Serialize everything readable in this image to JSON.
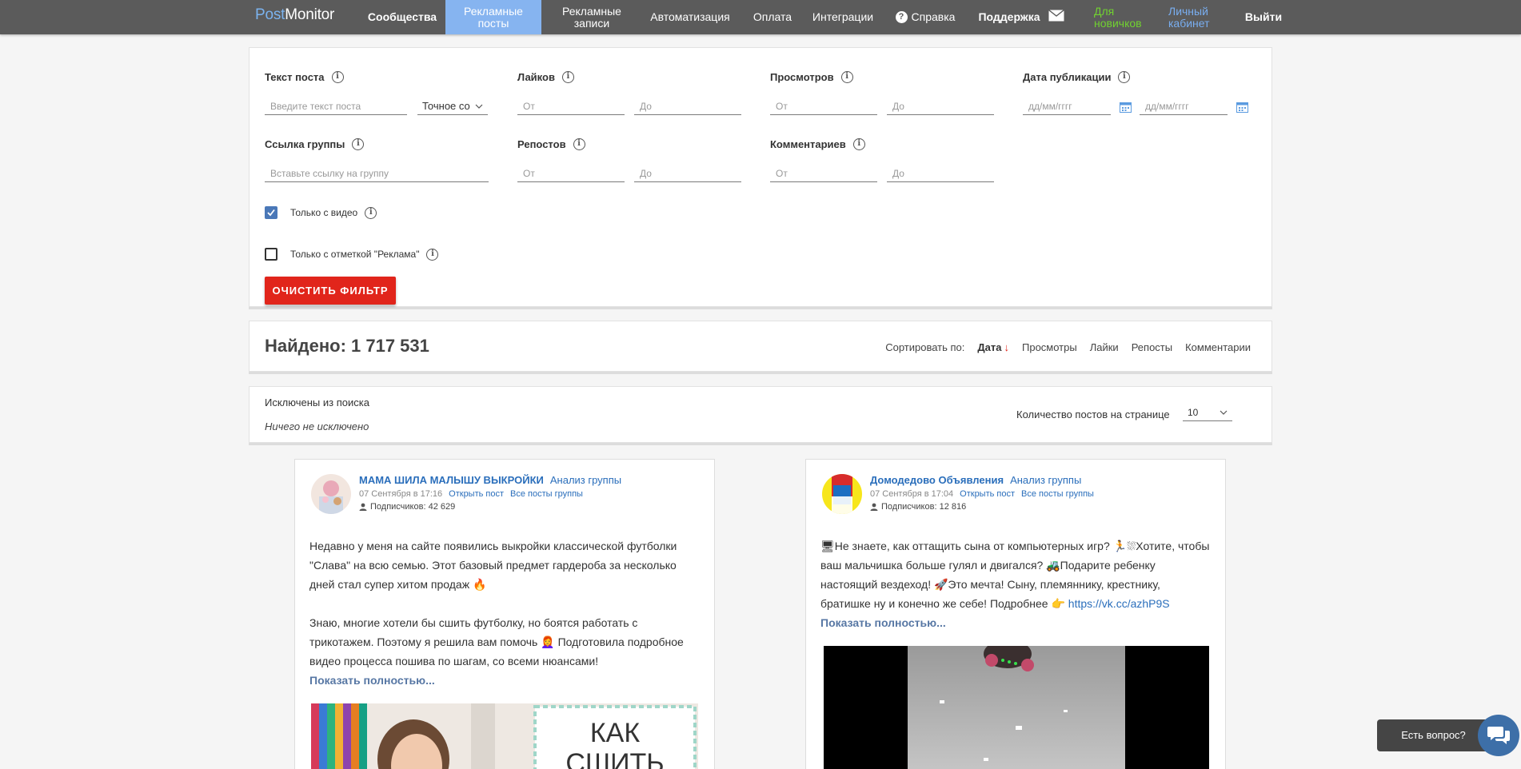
{
  "nav": {
    "logo_a": "Post",
    "logo_b": "Monitor",
    "items": [
      {
        "label": "Сообщества"
      },
      {
        "label": "Рекламные посты",
        "l1": "Рекламные",
        "l2": "посты"
      },
      {
        "label": "Рекламные записи",
        "l1": "Рекламные",
        "l2": "записи"
      },
      {
        "label": "Автоматизация"
      },
      {
        "label": "Оплата"
      },
      {
        "label": "Интеграции"
      },
      {
        "label": "Справка"
      },
      {
        "label": "Поддержка"
      },
      {
        "l1": "Для",
        "l2": "новичков"
      },
      {
        "l1": "Личный",
        "l2": "кабинет"
      },
      {
        "label": "Выйти"
      }
    ]
  },
  "filter": {
    "post_text_label": "Текст поста",
    "post_text_placeholder": "Введите текст поста",
    "match_mode": "Точное со",
    "likes_label": "Лайков",
    "views_label": "Просмотров",
    "date_label": "Дата публикации",
    "group_link_label": "Ссылка группы",
    "group_link_placeholder": "Вставьте ссылку на группу",
    "reposts_label": "Репостов",
    "comments_label": "Комментариев",
    "from_placeholder": "От",
    "to_placeholder": "До",
    "date_placeholder": "дд/мм/гггг",
    "only_video_label": "Только с видео",
    "only_video_checked": true,
    "only_ad_label": "Только с отметкой \"Реклама\"",
    "only_ad_checked": false,
    "clear_button": "Очистить фильтр"
  },
  "results": {
    "found_label": "Найдено: 1 717 531",
    "sort_label": "Сортировать по:",
    "sort_options": [
      "Дата",
      "Просмотры",
      "Лайки",
      "Репосты",
      "Комментарии"
    ],
    "sort_arrow": "↓",
    "active_sort": "Дата"
  },
  "exclusions": {
    "title": "Исключены из поиска",
    "none_text": "Ничего не исключено",
    "per_page_label": "Количество постов на странице",
    "per_page_value": "10"
  },
  "posts": [
    {
      "group_name": "МАМА ШИЛА МАЛЫШУ ВЫКРОЙКИ",
      "analysis_link": "Анализ группы",
      "date": "07 Сентября в 17:16",
      "open_post": "Открыть пост",
      "all_posts": "Все посты группы",
      "subscribers_label": "Подписчиков:",
      "subscribers": "42 629",
      "text_1": "Недавно у меня на сайте появились выкройки классической футболки \"Слава\" на всю семью. Этот базовый предмет гардероба за несколько дней стал супер хитом продаж 🔥",
      "text_2": "Знаю, многие хотели бы сшить футболку, но боятся работать с трикотажем. Поэтому я решила вам помочь 👩‍🦰 Подготовила подробное видео процесса пошива по шагам, со всеми нюансами!",
      "show_more": "Показать полностью...",
      "image_text_1": "КАК",
      "image_text_2": "СШИТЬ"
    },
    {
      "group_name": "Домодедово Объявления",
      "analysis_link": "Анализ группы",
      "date": "07 Сентября в 17:04",
      "open_post": "Открыть пост",
      "all_posts": "Все посты группы",
      "subscribers_label": "Подписчиков:",
      "subscribers": "12 816",
      "text_1": "🖥Не знаете, как оттащить сына от компьютерных игр? 🏃⛆Хотите, чтобы ваш мальчишка больше гулял и двигался? 🚜Подарите ребенку настоящий вездеход! 🚀Это мечта! Сыну, племяннику, крестнику, братишке ну и конечно же себе! Подробнее 👉 ",
      "link": "https://vk.cc/azhP9S",
      "show_more": "Показать полностью..."
    }
  ],
  "help": {
    "bubble_text": "Есть вопрос?"
  },
  "colors": {
    "nav_bg": "#5b5b5b",
    "nav_active": "#86b4f0",
    "accent_red": "#e1251b",
    "link_blue": "#2a6ebb",
    "beginner_green": "#71d230"
  }
}
